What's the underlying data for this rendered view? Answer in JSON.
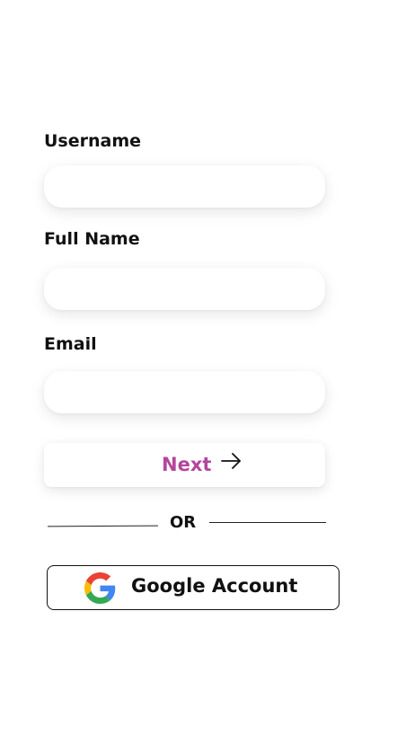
{
  "form": {
    "username": {
      "label": "Username",
      "value": "",
      "placeholder": ""
    },
    "full_name": {
      "label": "Full Name",
      "value": "",
      "placeholder": ""
    },
    "email": {
      "label": "Email",
      "value": "",
      "placeholder": ""
    }
  },
  "actions": {
    "next_label": "Next",
    "next_icon": "arrow-right-icon",
    "or_label": "OR",
    "google_label": "Google Account",
    "google_icon": "google-logo-icon"
  },
  "colors": {
    "accent": "#b4459d",
    "text": "#111111",
    "background": "#ffffff"
  }
}
